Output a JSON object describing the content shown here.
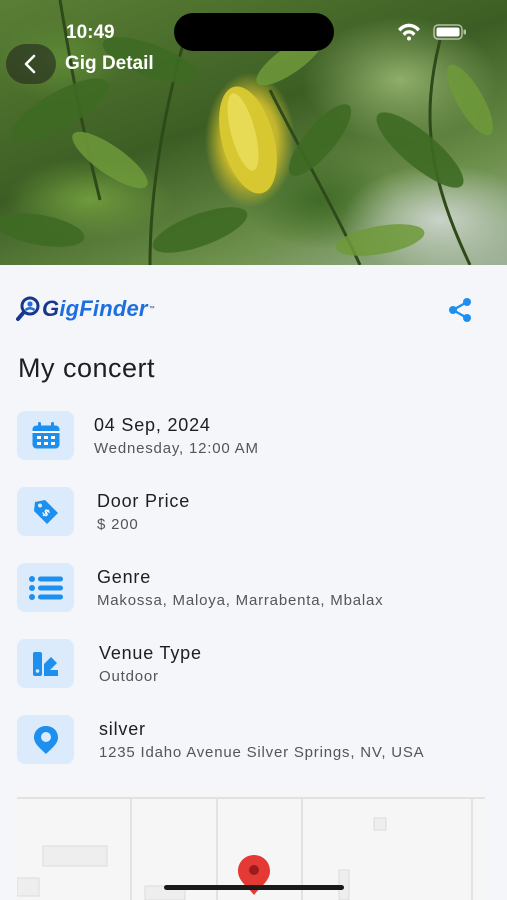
{
  "status_bar": {
    "time": "10:49"
  },
  "nav": {
    "title": "Gig Detail"
  },
  "brand": {
    "logo_text_g": "G",
    "logo_text_rest": "igFinder",
    "trademark": "™"
  },
  "event": {
    "title": "My concert"
  },
  "details": [
    {
      "icon": "calendar-icon",
      "primary": "04 Sep, 2024",
      "secondary": "Wednesday,  12:00 AM"
    },
    {
      "icon": "price-tag-icon",
      "primary": "Door Price",
      "secondary": "$ 200"
    },
    {
      "icon": "list-icon",
      "primary": "Genre",
      "secondary": "Makossa, Maloya, Marrabenta, Mbalax"
    },
    {
      "icon": "venue-type-icon",
      "primary": "Venue Type",
      "secondary": "Outdoor"
    },
    {
      "icon": "location-pin-icon",
      "primary": "silver",
      "secondary": "1235 Idaho Avenue Silver Springs, NV, USA"
    }
  ],
  "colors": {
    "accent": "#1d8fee",
    "icon_bg": "#dcebfb",
    "brand_dark": "#16378c",
    "map_pin": "#e53935"
  }
}
